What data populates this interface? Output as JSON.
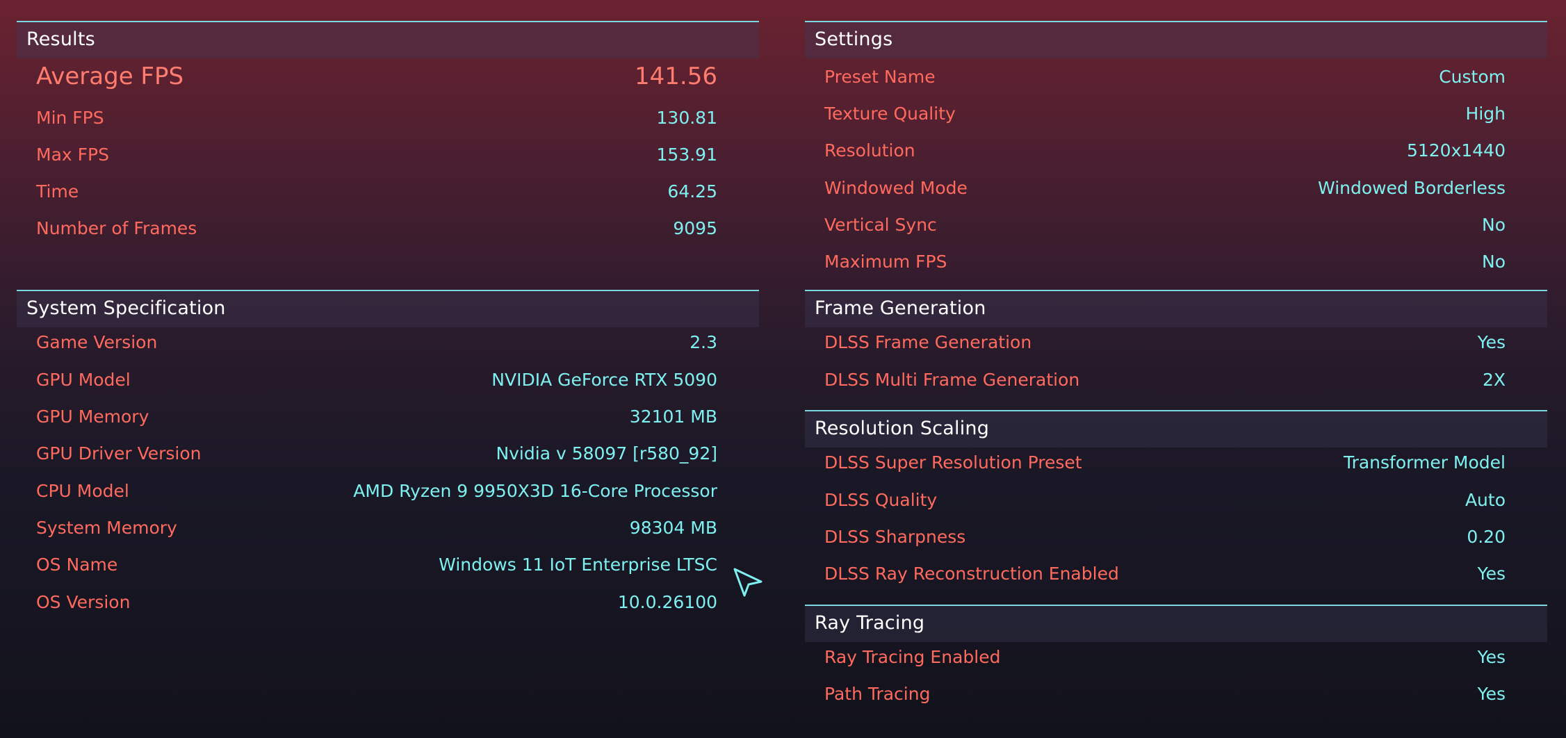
{
  "results": {
    "title": "Results",
    "average": {
      "label": "Average FPS",
      "value": "141.56"
    },
    "rows": [
      {
        "label": "Min FPS",
        "value": "130.81"
      },
      {
        "label": "Max FPS",
        "value": "153.91"
      },
      {
        "label": "Time",
        "value": "64.25"
      },
      {
        "label": "Number of Frames",
        "value": "9095"
      }
    ]
  },
  "system": {
    "title": "System Specification",
    "rows": [
      {
        "label": "Game Version",
        "value": "2.3"
      },
      {
        "label": "GPU Model",
        "value": "NVIDIA GeForce RTX 5090"
      },
      {
        "label": "GPU Memory",
        "value": "32101 MB"
      },
      {
        "label": "GPU Driver Version",
        "value": "Nvidia v 58097 [r580_92]"
      },
      {
        "label": "CPU Model",
        "value": "AMD Ryzen 9 9950X3D 16-Core Processor"
      },
      {
        "label": "System Memory",
        "value": "98304 MB"
      },
      {
        "label": "OS Name",
        "value": "Windows 11 IoT Enterprise LTSC"
      },
      {
        "label": "OS Version",
        "value": "10.0.26100"
      }
    ]
  },
  "settings": {
    "title": "Settings",
    "rows": [
      {
        "label": "Preset Name",
        "value": "Custom"
      },
      {
        "label": "Texture Quality",
        "value": "High"
      },
      {
        "label": "Resolution",
        "value": "5120x1440"
      },
      {
        "label": "Windowed Mode",
        "value": "Windowed Borderless"
      },
      {
        "label": "Vertical Sync",
        "value": "No"
      },
      {
        "label": "Maximum FPS",
        "value": "No"
      }
    ]
  },
  "frame_generation": {
    "title": "Frame Generation",
    "rows": [
      {
        "label": "DLSS Frame Generation",
        "value": "Yes"
      },
      {
        "label": "DLSS Multi Frame Generation",
        "value": "2X"
      }
    ]
  },
  "resolution_scaling": {
    "title": "Resolution Scaling",
    "rows": [
      {
        "label": "DLSS Super Resolution Preset",
        "value": "Transformer Model"
      },
      {
        "label": "DLSS Quality",
        "value": "Auto"
      },
      {
        "label": "DLSS Sharpness",
        "value": "0.20"
      },
      {
        "label": "DLSS Ray Reconstruction Enabled",
        "value": "Yes"
      }
    ]
  },
  "ray_tracing": {
    "title": "Ray Tracing",
    "rows": [
      {
        "label": "Ray Tracing Enabled",
        "value": "Yes"
      },
      {
        "label": "Path Tracing",
        "value": "Yes"
      }
    ]
  },
  "cursor": {
    "icon": "mouse-pointer-icon"
  },
  "colors": {
    "label": "#ff6a5e",
    "value": "#7ff0f0",
    "divider": "#79d8e0",
    "header_text": "#ffffff"
  }
}
